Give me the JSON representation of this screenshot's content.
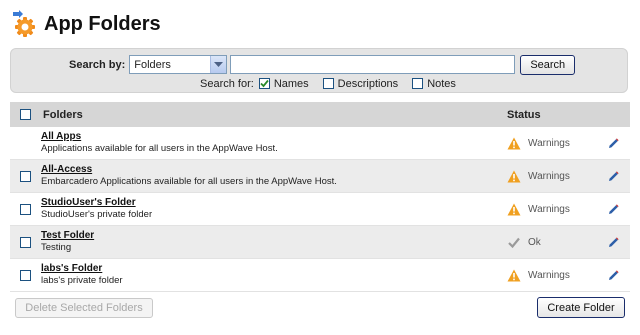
{
  "header": {
    "title": "App Folders",
    "icon": "gear-folder-icon"
  },
  "search": {
    "label": "Search by:",
    "select_value": "Folders",
    "input_value": "",
    "button_label": "Search",
    "search_for_label": "Search for:",
    "options": [
      {
        "label": "Names",
        "checked": true
      },
      {
        "label": "Descriptions",
        "checked": false
      },
      {
        "label": "Notes",
        "checked": false
      }
    ]
  },
  "table": {
    "columns": {
      "folders": "Folders",
      "status": "Status"
    },
    "rows": [
      {
        "title": "All Apps",
        "desc": "Applications available for all users in the AppWave Host.",
        "status": "Warnings",
        "status_icon": "warning-icon",
        "has_checkbox": false
      },
      {
        "title": "All-Access",
        "desc": "Embarcadero Applications available for all users in the AppWave Host.",
        "status": "Warnings",
        "status_icon": "warning-icon",
        "has_checkbox": true
      },
      {
        "title": "StudioUser's Folder",
        "desc": "StudioUser's private folder",
        "status": "Warnings",
        "status_icon": "warning-icon",
        "has_checkbox": true
      },
      {
        "title": "Test Folder",
        "desc": "Testing",
        "status": "Ok",
        "status_icon": "checkmark-icon",
        "has_checkbox": true
      },
      {
        "title": "labs's Folder",
        "desc": "labs's private folder",
        "status": "Warnings",
        "status_icon": "warning-icon",
        "has_checkbox": true
      }
    ]
  },
  "footer": {
    "delete_label": "Delete Selected Folders",
    "create_label": "Create Folder"
  },
  "colors": {
    "warning": "#f0a020",
    "ok": "#9a9a9a",
    "edit": "#2d5fa8",
    "header_bg": "#d6d6d6",
    "row_alt": "#ececec"
  }
}
